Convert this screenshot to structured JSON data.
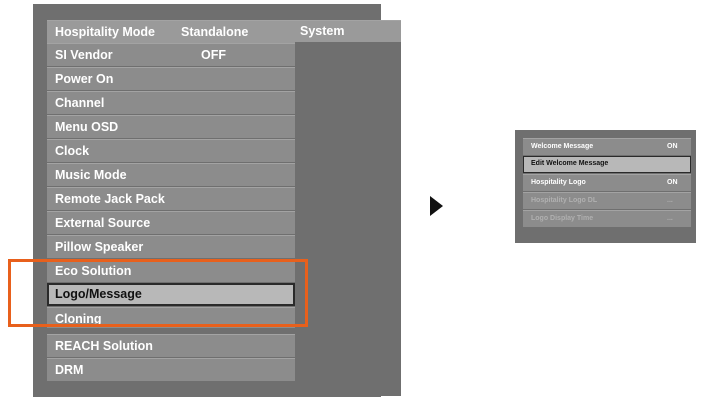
{
  "main_menu": {
    "header": {
      "label": "Hospitality Mode",
      "value": "Standalone"
    },
    "items": [
      {
        "label": "SI Vendor",
        "value": "OFF"
      },
      {
        "label": "Power On",
        "value": ""
      },
      {
        "label": "Channel",
        "value": ""
      },
      {
        "label": "Menu OSD",
        "value": ""
      },
      {
        "label": "Clock",
        "value": ""
      },
      {
        "label": "Music Mode",
        "value": ""
      },
      {
        "label": "Remote Jack Pack",
        "value": ""
      },
      {
        "label": "External Source",
        "value": ""
      },
      {
        "label": "Pillow Speaker",
        "value": ""
      },
      {
        "label": "Eco Solution",
        "value": ""
      },
      {
        "label": "Logo/Message",
        "value": ""
      },
      {
        "label": "Cloning",
        "value": ""
      },
      {
        "label": "REACH Solution",
        "value": ""
      },
      {
        "label": "DRM",
        "value": ""
      }
    ],
    "selected_index": 10
  },
  "system_column": {
    "label": "System"
  },
  "submenu": {
    "items": [
      {
        "label": "Welcome Message",
        "value": "ON",
        "state": "normal"
      },
      {
        "label": "Edit Welcome Message",
        "value": "",
        "state": "selected"
      },
      {
        "label": "Hospitality Logo",
        "value": "ON",
        "state": "normal"
      },
      {
        "label": "Hospitality Logo DL",
        "value": "...",
        "state": "disabled"
      },
      {
        "label": "Logo Display Time",
        "value": "...",
        "state": "disabled"
      }
    ]
  },
  "colors": {
    "panel_bg": "#6f6f6f",
    "row_bg": "#8c8c8c",
    "selected_bg": "#b8b8b8",
    "highlight_outline": "#e8601c"
  },
  "icons": {
    "arrow": "triangle-right-icon"
  }
}
